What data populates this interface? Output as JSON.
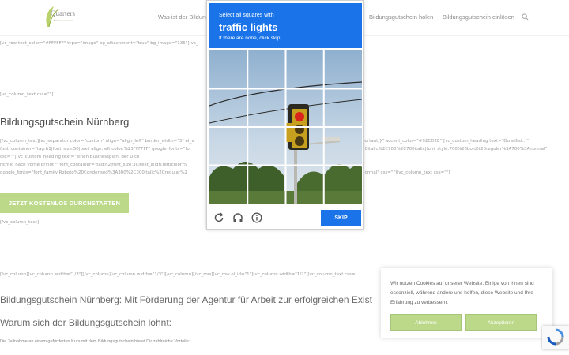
{
  "header": {
    "logo_text": "Quarters",
    "logo_sub": "Bildungszentrum",
    "nav_items": [
      "Was ist der Bildung",
      "Bildungsgutschein holen",
      "Bildungsgutschein einlösen"
    ]
  },
  "shortcodes": {
    "row1": "[vc_row text_color=\"#FFFFFF\" type=\"image\" bg_attachment=\"true\" bg_image=\"136\"][vc_",
    "col_text": "[vc_column_text css=\"\"]",
    "line_a": "[/vc_column_text][vc_separator color=\"custom\" align=\"align_left\" border_width=\"3\" el_v",
    "line_a2": "portant;}\" accent_color=\"#92CD2E\"][vc_custom_heading text=\"Du willst…\"",
    "line_b": "font_container=\"tag:h1|font_size:50|text_align:left|color:%23FFFFFF\" google_fonts=\"fo",
    "line_b2": "2Citalic%2C700%2C700italic|font_style:700%20bold%20regular%3A700%3Anormal\"",
    "line_c": "css=\"\"][vc_custom_heading text=\"einen Businessplan, der Dich",
    "line_d": "richtig nach vorne bringt?\" font_container=\"tag:h2|font_size:30|text_align:left|color:%",
    "line_e": "google_fonts=\"font_family:Roboto%20Condensed%3A300%2C300italic%2Cregular%2",
    "line_e2": "normal\" css=\"\"][vc_column_text css=\"\"]",
    "col_text_end": "[/vc_column_text]",
    "row2": "[/vc_column][vc_column width=\"1/3\"][/vc_column][vc_column width=\"1/3\"][/vc_column][/vc_row][vc_row el_id=\"1\"][vc_column width=\"1/2\"][vc_column_text css="
  },
  "main": {
    "heading": "Bildungsgutschein Nürnberg",
    "cta_label": "JETZT KOSTENLOS DURCHSTARTEN",
    "heading2": "Bildungsgutschein Nürnberg: Mit Förderung der Agentur für Arbeit zur erfolgreichen Exist",
    "heading3": "Warum sich der Bildungsgutschein lohnt:",
    "paragraph": "Die Teilnahme an einem geförderten Kurs mit dem Bildungsgutschein bietet Dir zahlreiche Vorteile:"
  },
  "captcha": {
    "instruction": "Select all squares with",
    "target": "traffic lights",
    "hint": "If there are none, click skip",
    "skip_label": "SKIP",
    "icons": [
      "reload-icon",
      "audio-icon",
      "info-icon"
    ],
    "accent": "#1a73e8"
  },
  "cookie": {
    "text": "Wir nutzen Cookies auf unserer Website. Einige von ihnen sind essenziell, während andere uns helfen, diese Website und Ihre Erfahrung zu verbessern.",
    "decline_label": "Ablehnen",
    "accept_label": "Akzeptieren",
    "button_color": "#bcd98a"
  }
}
